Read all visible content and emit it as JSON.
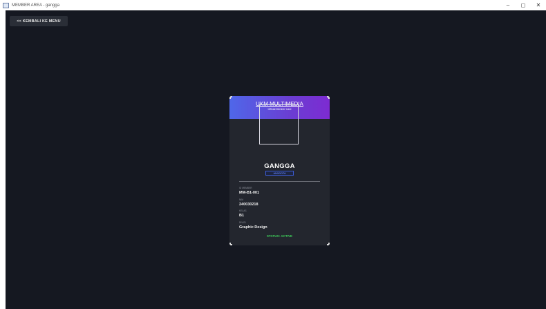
{
  "window": {
    "title": "MEMBER AREA - gangga",
    "minimize_glyph": "–",
    "maximize_glyph": "◻",
    "close_glyph": "✕"
  },
  "toolbar": {
    "back_label": "<< KEMBALI KE MENU"
  },
  "card": {
    "org_name": "UKM MULTIMEDIA",
    "subtitle": "Official Member Card",
    "member_name": "GANGGA",
    "role": "ANGGOTA",
    "fields": [
      {
        "label": "ID MEMBER",
        "value": "MM-B1-001"
      },
      {
        "label": "NIM",
        "value": "240030218"
      },
      {
        "label": "KELAS",
        "value": "B1"
      },
      {
        "label": "DIVISI",
        "value": "Graphic Design"
      }
    ],
    "status": "STATUS: ACTIVE"
  },
  "colors": {
    "background": "#151821",
    "card": "#23262e",
    "header_start": "#4f67e9",
    "header_end": "#7d2bd2",
    "status_green": "#3ecf5a",
    "badge_blue": "#3b5bd6"
  }
}
